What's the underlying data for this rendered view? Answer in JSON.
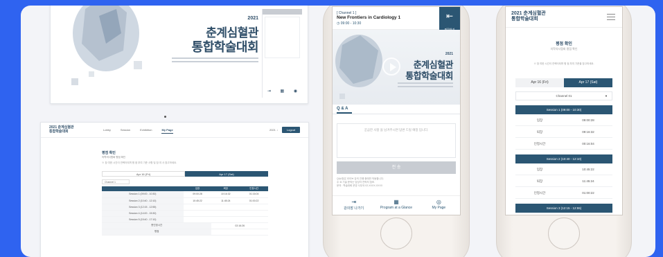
{
  "top_screen": {
    "year": "2021",
    "title_line1": "춘계심혈관",
    "title_line2": "통합학술대회"
  },
  "web_attendance": {
    "logo": "2021 춘계심혈관 통합학술대회",
    "nav": [
      "Lobby",
      "Session",
      "Exhibition",
      "My Page"
    ],
    "user": "2021 ↓",
    "logout": "Logout",
    "title": "평점 확인",
    "subtitle": "의학의사협회 평점 확인",
    "note": "※ 참 여한 시간이 연렉터되며 평 점 부여 기준 사항 및 참 여 사 참고하세요.",
    "tabs": [
      "Apr 16 (Fri)",
      "Apr 17 (Sat)"
    ],
    "select": "Channel 1",
    "columns": [
      "",
      "입장",
      "퇴장",
      "인정시간"
    ],
    "rows": [
      [
        "Session 1 (09:00 - 10:30)",
        "09:00:28",
        "10:16:32",
        "01:16:04"
      ],
      [
        "Session 2 (10:40 - 12:10)",
        "10:45:22",
        "11:45:24",
        "01:00:22"
      ],
      [
        "Session 3 (12:15 - 12:55)",
        "",
        "",
        ""
      ],
      [
        "Session 4 (14:00 - 15:30)",
        "",
        "",
        ""
      ],
      [
        "Session 5 (15:40 - 17:10)",
        "",
        "",
        ""
      ]
    ],
    "total_label": "총인정시간",
    "total_value": "02:16:26",
    "result_label": "평점"
  },
  "phone_live": {
    "channel": "[ Channel 1 ]",
    "title": "New Frontiers in Cardiology 1",
    "time": "09:00 - 10:30",
    "exit_label": "퇴장하기",
    "year": "2021",
    "title_line1": "춘계심혈관",
    "title_line2": "통합학술대회",
    "qa_tab": "Q & A",
    "qa_placeholder": "궁금한 사항 을 남겨주시면 답변 드릴 예정 입니다.",
    "send": "전 송",
    "notes": [
      "Q&A창은 라이브 강의 진행 중에만 작동합니다.",
      "주 요 기술 문의는 담당자 연락처 참조.",
      "문의 : 학술대회 운영 사무국 02-XXXX-XXXX"
    ],
    "footer": [
      "강의장 나가기",
      "Program at a Glance",
      "My Page"
    ]
  },
  "phone_attendance": {
    "logo_line1": "2021 춘계심혈관",
    "logo_line2": "통합학술대회",
    "title": "평점 확인",
    "subtitle": "의학의사협회 평점 확인",
    "note": "※ 참 여한 시간이 연렉터되며 평 점 부여 기준을 참고하세요.",
    "tabs": [
      "Apr 16 (Fri)",
      "Apr 17 (Sat)"
    ],
    "select": "Channel 01",
    "sessions": [
      {
        "header": "Session 1 (09:00 - 10:30)",
        "rows": [
          [
            "입장",
            "09:00:28"
          ],
          [
            "퇴장",
            "09:16:32"
          ],
          [
            "인정시간",
            "00:16:04"
          ]
        ]
      },
      {
        "header": "Session 2 (10:40 - 12:10)",
        "rows": [
          [
            "입장",
            "10:45:22"
          ],
          [
            "퇴장",
            "11:45:24"
          ],
          [
            "인정시간",
            "01:00:22"
          ]
        ]
      },
      {
        "header": "Session 3 (12:15 - 12:55)",
        "rows": []
      }
    ]
  }
}
